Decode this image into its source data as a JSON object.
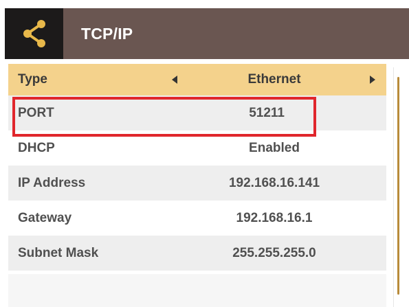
{
  "header": {
    "title": "TCP/IP",
    "icon": "share-icon"
  },
  "rows": [
    {
      "label": "Type",
      "value": "Ethernet"
    },
    {
      "label": "PORT",
      "value": "51211"
    },
    {
      "label": "DHCP",
      "value": "Enabled"
    },
    {
      "label": "IP Address",
      "value": "192.168.16.141"
    },
    {
      "label": "Gateway",
      "value": "192.168.16.1"
    },
    {
      "label": "Subnet Mask",
      "value": "255.255.255.0"
    }
  ],
  "colors": {
    "header_bg": "#6a5651",
    "icon_box_bg": "#1c1a1a",
    "accent": "#e8b84a",
    "selected_row_bg": "#f4d28c",
    "highlight_border": "#e0262c"
  }
}
